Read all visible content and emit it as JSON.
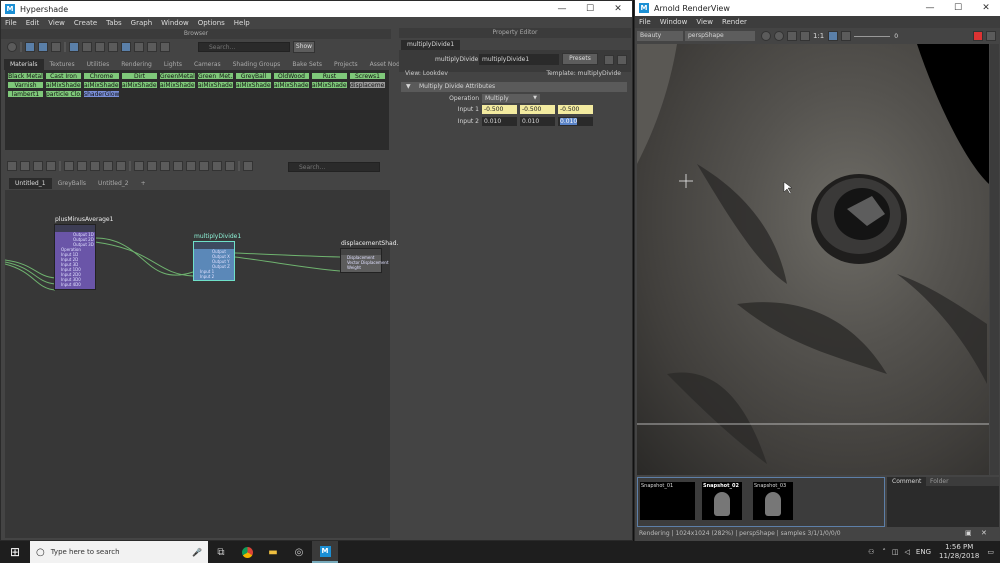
{
  "hypershade": {
    "title": "Hypershade",
    "menu": [
      "File",
      "Edit",
      "View",
      "Create",
      "Tabs",
      "Graph",
      "Window",
      "Options",
      "Help"
    ],
    "browser": {
      "header": "Browser",
      "search_placeholder": "Search...",
      "show_label": "Show",
      "tabs": [
        "Materials",
        "Textures",
        "Utilities",
        "Rendering",
        "Lights",
        "Cameras",
        "Shading Groups",
        "Bake Sets",
        "Projects",
        "Asset Nodes"
      ],
      "materials_row1": [
        "Black Metal",
        "Cast Iron",
        "Chrome",
        "Dirt",
        "GreenMetal...",
        "Green_Met...",
        "GreyBall",
        "OldWood",
        "Rust",
        "Screws1"
      ],
      "materials_row2": [
        "Varnish",
        "aiMixShader1",
        "aiMixShader2",
        "aiMixShader3",
        "aiMixShader4",
        "aiMixShader5",
        "aiMixShader6",
        "aiMixShader7",
        "aiMixShader8",
        "displaceme..."
      ],
      "materials_row3": [
        "lambert1",
        "particle Clo...",
        "shaderGlow1"
      ]
    },
    "graph": {
      "search_placeholder": "Search...",
      "tabs": [
        "Untitled_1",
        "GreyBalls",
        "Untitled_2",
        "+"
      ],
      "nodes": {
        "pma": {
          "name": "plusMinusAverage1",
          "ports_out": [
            "Output 1D",
            "Output 2D",
            "Output 3D"
          ],
          "ports_in": [
            "Operation",
            "Input 1D",
            "Input 2D",
            "Input 3D",
            "Input 1D0",
            "Input 2D0",
            "Input 3D0",
            "Input 4D0"
          ]
        },
        "md": {
          "name": "multiplyDivide1",
          "ports_out": [
            "Output",
            "Output X",
            "Output Y",
            "Output Z"
          ],
          "ports_in": [
            "Input 1",
            "Input 2"
          ]
        },
        "ds": {
          "name": "displacementShad...",
          "ports": [
            "Displacement",
            "Vector Displacement",
            "Weight"
          ]
        }
      }
    }
  },
  "property_editor": {
    "header": "Property Editor",
    "node_tab": "multiplyDivide1",
    "node_type_label": "multiplyDivide:",
    "node_name": "multiplyDivide1",
    "presets_label": "Presets",
    "view_label": "View: Lookdev",
    "template_label": "Template: multiplyDivide",
    "section": "Multiply Divide Attributes",
    "operation_label": "Operation",
    "operation_value": "Multiply",
    "input1_label": "Input 1",
    "input1": [
      "-0.500",
      "-0.500",
      "-0.500"
    ],
    "input2_label": "Input 2",
    "input2": [
      "0.010",
      "0.010",
      "0.010"
    ]
  },
  "render_view": {
    "title": "Arnold RenderView",
    "menu": [
      "File",
      "Window",
      "View",
      "Render"
    ],
    "aov": "Beauty",
    "camera": "perspShape",
    "ratio": "1:1",
    "exposure": "0",
    "snapshots": [
      "Snapshot_01",
      "Snapshot_02",
      "Snapshot_03"
    ],
    "side_tabs": [
      "Comment",
      "Folder"
    ],
    "status": "Rendering | 1024x1024 (282%) | perspShape | samples 3/1/1/0/0/0"
  },
  "taskbar": {
    "search_placeholder": "Type here to search",
    "lang": "ENG",
    "time": "1:56 PM",
    "date": "11/28/2018"
  },
  "colors": {
    "accent": "#5a7fa8",
    "material_green": "#7fc87a",
    "node_purple": "#6a55a8",
    "node_teal": "#5b88b8",
    "input_yellow": "#f3eba0"
  }
}
